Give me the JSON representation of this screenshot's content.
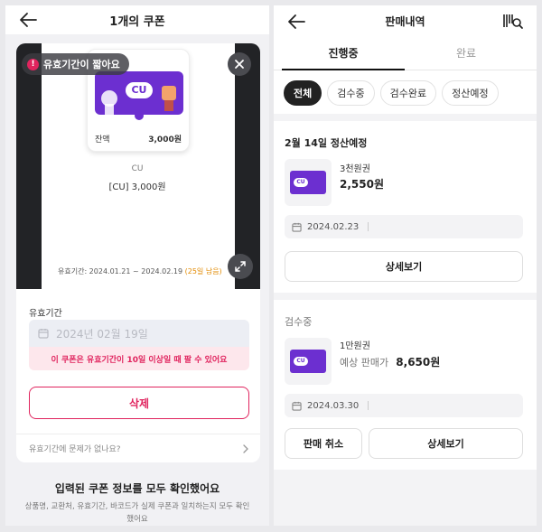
{
  "left": {
    "header": {
      "title": "1개의 쿠폰"
    },
    "badge": {
      "text": "유효기간이 짧아요",
      "alert_glyph": "!"
    },
    "coupon_card": {
      "brand_logo": "CU",
      "balance_label": "잔액",
      "balance_value": "3,000원"
    },
    "coupon_info": {
      "brand": "CU",
      "product": "[CU] 3,000원"
    },
    "validity": {
      "period": "유효기간: 2024.01.21 ~ 2024.02.19",
      "remaining": "(25일 남음)"
    },
    "form": {
      "field_label": "유효기간",
      "date_value": "2024년 02월 19일",
      "warning": "이 쿠폰은 유효기간이 10일 이상일 때 팔 수 있어요",
      "delete_label": "삭제",
      "problem_link": "유효기간에 문제가 없나요?"
    },
    "confirm": {
      "title": "입력된 쿠폰 정보를 모두 확인했어요",
      "description": "상품명, 교환처, 유효기간, 바코드가 실제 쿠폰과 일치하는지 모두 확인했어요"
    }
  },
  "right": {
    "header": {
      "title": "판매내역"
    },
    "tabs": [
      {
        "label": "진행중",
        "active": true
      },
      {
        "label": "완료",
        "active": false
      }
    ],
    "filters": [
      {
        "label": "전체",
        "active": true
      },
      {
        "label": "검수중"
      },
      {
        "label": "검수완료"
      },
      {
        "label": "정산예정"
      }
    ],
    "sections": [
      {
        "title": "2월 14일 정산예정",
        "item_name": "3천원권",
        "price_prefix": "",
        "price": "2,550원",
        "thumb_logo": "CU",
        "date": "2024.02.23",
        "buttons": {
          "detail": "상세보기"
        }
      },
      {
        "title": "검수중",
        "item_name": "1만원권",
        "price_prefix": "예상 판매가",
        "price": "8,650원",
        "thumb_logo": "CU",
        "date": "2024.03.30",
        "buttons": {
          "cancel": "판매 취소",
          "detail": "상세보기"
        }
      }
    ]
  },
  "colors": {
    "accent_pink": "#e0245e",
    "cu_purple": "#6c2fd0",
    "remaining_orange": "#e28a00"
  },
  "icons": [
    "back-arrow-icon",
    "alert-icon",
    "close-icon",
    "expand-icon",
    "calendar-icon",
    "chevron-right-icon",
    "barcode-search-icon"
  ]
}
